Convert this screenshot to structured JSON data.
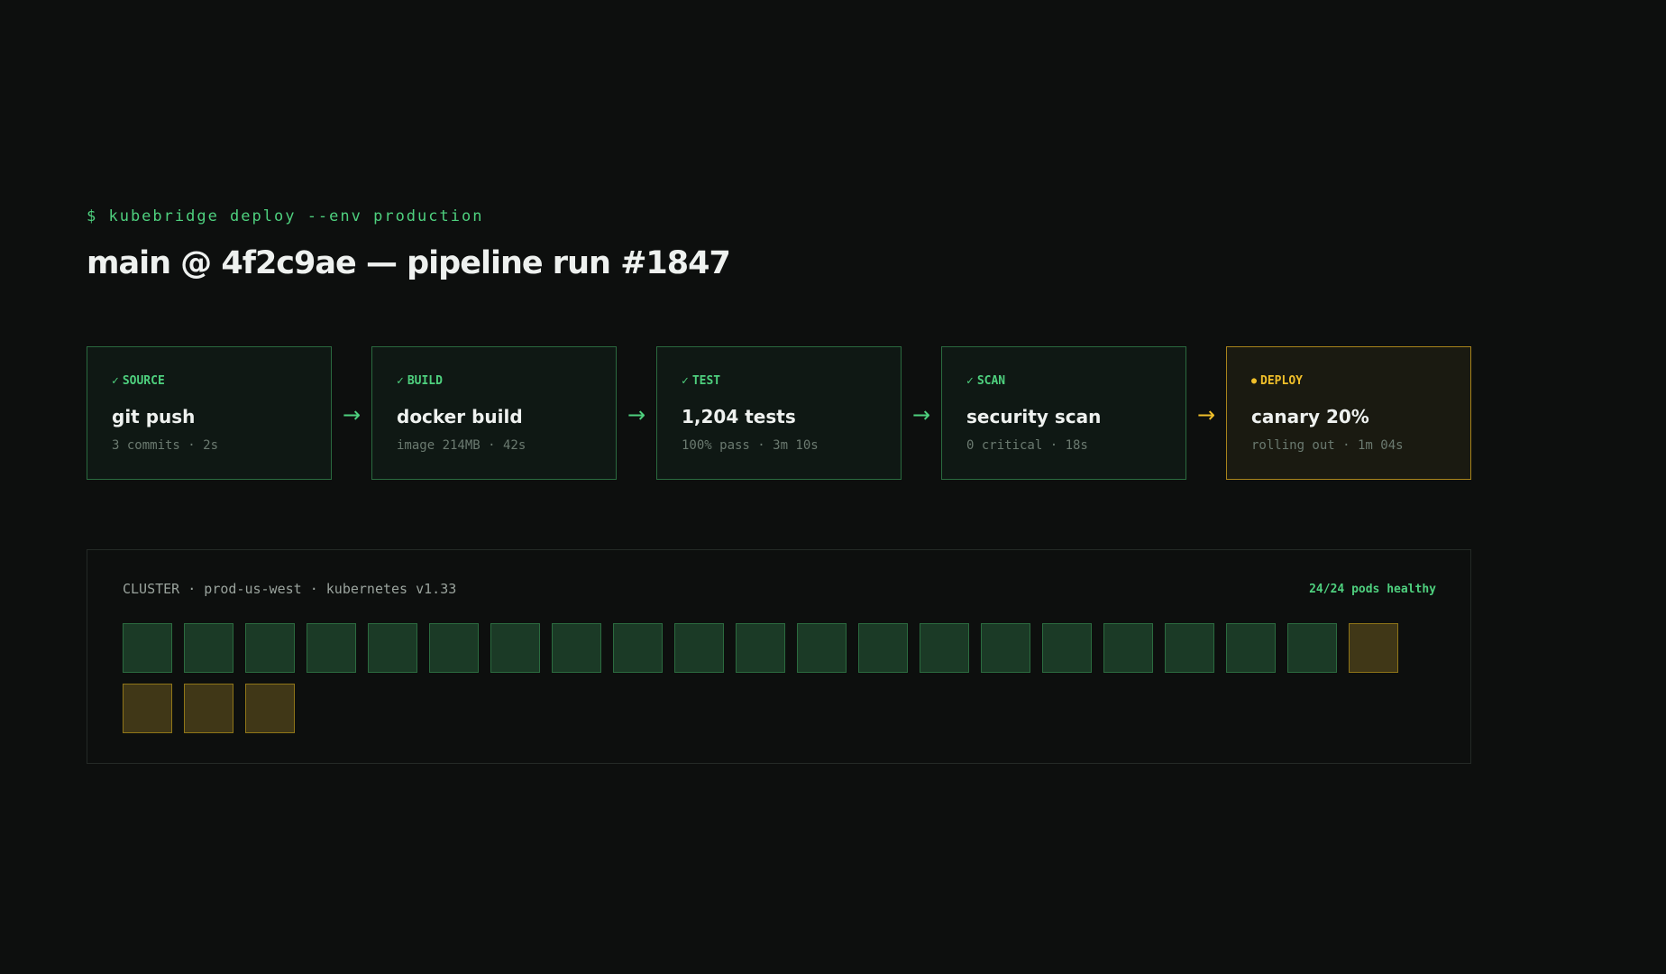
{
  "header": {
    "command": "$ kubebridge deploy --env production",
    "title": "main @ 4f2c9ae — pipeline run #1847"
  },
  "pipeline": {
    "stages": [
      {
        "status_icon": "✓",
        "label": "SOURCE",
        "name": "git push",
        "meta": "3 commits · 2s",
        "state": "done"
      },
      {
        "status_icon": "✓",
        "label": "BUILD",
        "name": "docker build",
        "meta": "image 214MB · 42s",
        "state": "done"
      },
      {
        "status_icon": "✓",
        "label": "TEST",
        "name": "1,204 tests",
        "meta": "100% pass · 3m 10s",
        "state": "done"
      },
      {
        "status_icon": "✓",
        "label": "SCAN",
        "name": "security scan",
        "meta": "0 critical · 18s",
        "state": "done"
      },
      {
        "status_icon": "●",
        "label": "DEPLOY",
        "name": "canary 20%",
        "meta": "rolling out · 1m 04s",
        "state": "running"
      }
    ],
    "arrow": "→"
  },
  "cluster": {
    "label": "CLUSTER · prod-us-west · kubernetes v1.33",
    "health": "24/24 pods healthy",
    "pods": [
      "healthy",
      "healthy",
      "healthy",
      "healthy",
      "healthy",
      "healthy",
      "healthy",
      "healthy",
      "healthy",
      "healthy",
      "healthy",
      "healthy",
      "healthy",
      "healthy",
      "healthy",
      "healthy",
      "healthy",
      "healthy",
      "healthy",
      "healthy",
      "updating",
      "updating",
      "updating",
      "updating"
    ]
  },
  "colors": {
    "background": "#0d0f0e",
    "success": "#4ed07e",
    "warning": "#f0bf2a",
    "pod_healthy": "#1b3a26",
    "pod_updating": "#403717"
  },
  "icons": {
    "done": "check-icon",
    "running": "dot-icon",
    "connector": "arrow-right-icon"
  }
}
